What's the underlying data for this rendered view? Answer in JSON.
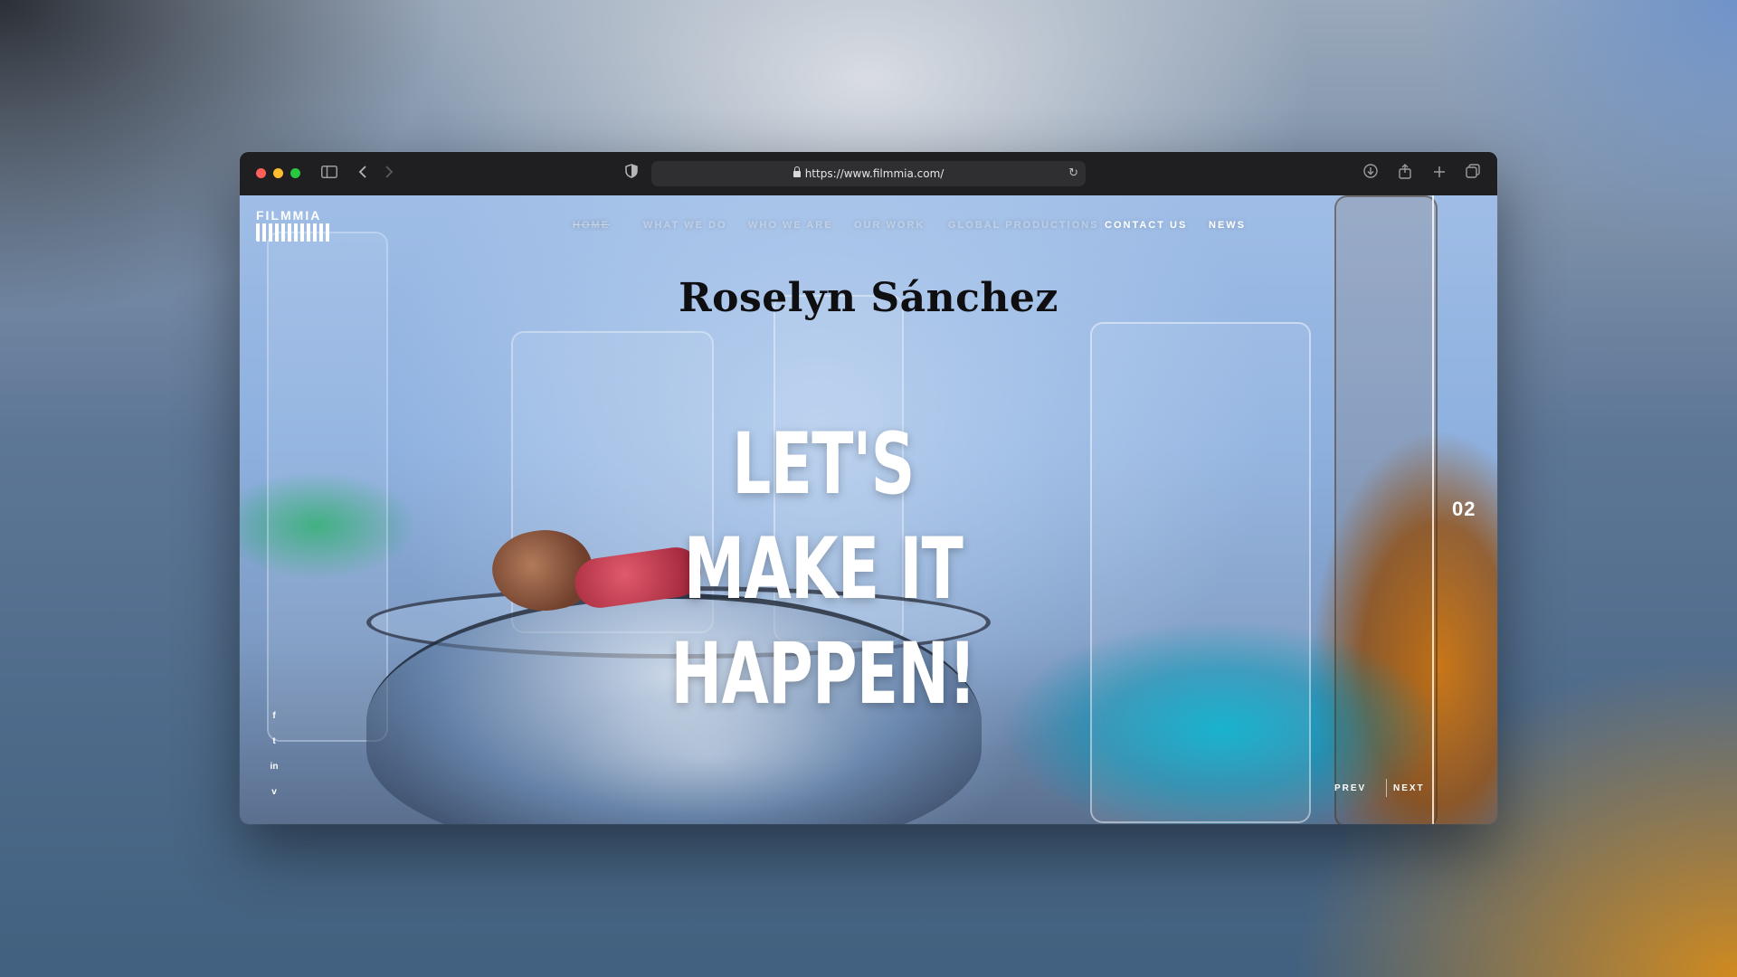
{
  "browser": {
    "url": "https://www.filmmia.com/",
    "reload_icon": "reload-icon",
    "icons": [
      "sidebar-icon",
      "back-icon",
      "forward-icon",
      "shield-icon",
      "download-icon",
      "share-icon",
      "new-tab-icon",
      "tabs-overview-icon"
    ]
  },
  "site": {
    "logo_text": "FILMMIA",
    "nav": [
      {
        "label": "HOME",
        "active": true
      },
      {
        "label": "WHAT WE DO"
      },
      {
        "label": "WHO WE ARE"
      },
      {
        "label": "OUR WORK"
      },
      {
        "label": "GLOBAL PRODUCTIONS"
      },
      {
        "label": "CONTACT US"
      },
      {
        "label": "NEWS"
      }
    ],
    "signature": "Roselyn Sánchez",
    "headline_line1": "LET'S MAKE IT",
    "headline_line2": "HAPPEN!",
    "slide_number": "02",
    "prev_label": "PREV",
    "next_label": "NEXT",
    "social": [
      {
        "icon": "facebook-icon",
        "glyph": "f"
      },
      {
        "icon": "twitter-icon",
        "glyph": "t"
      },
      {
        "icon": "linkedin-icon",
        "glyph": "in"
      },
      {
        "icon": "vimeo-icon",
        "glyph": "v"
      }
    ]
  },
  "colors": {
    "traffic_red": "#fe5f57",
    "traffic_yellow": "#febc2e",
    "traffic_green": "#28c840",
    "accent_teal": "#00afcd",
    "accent_amber": "#c97717"
  }
}
